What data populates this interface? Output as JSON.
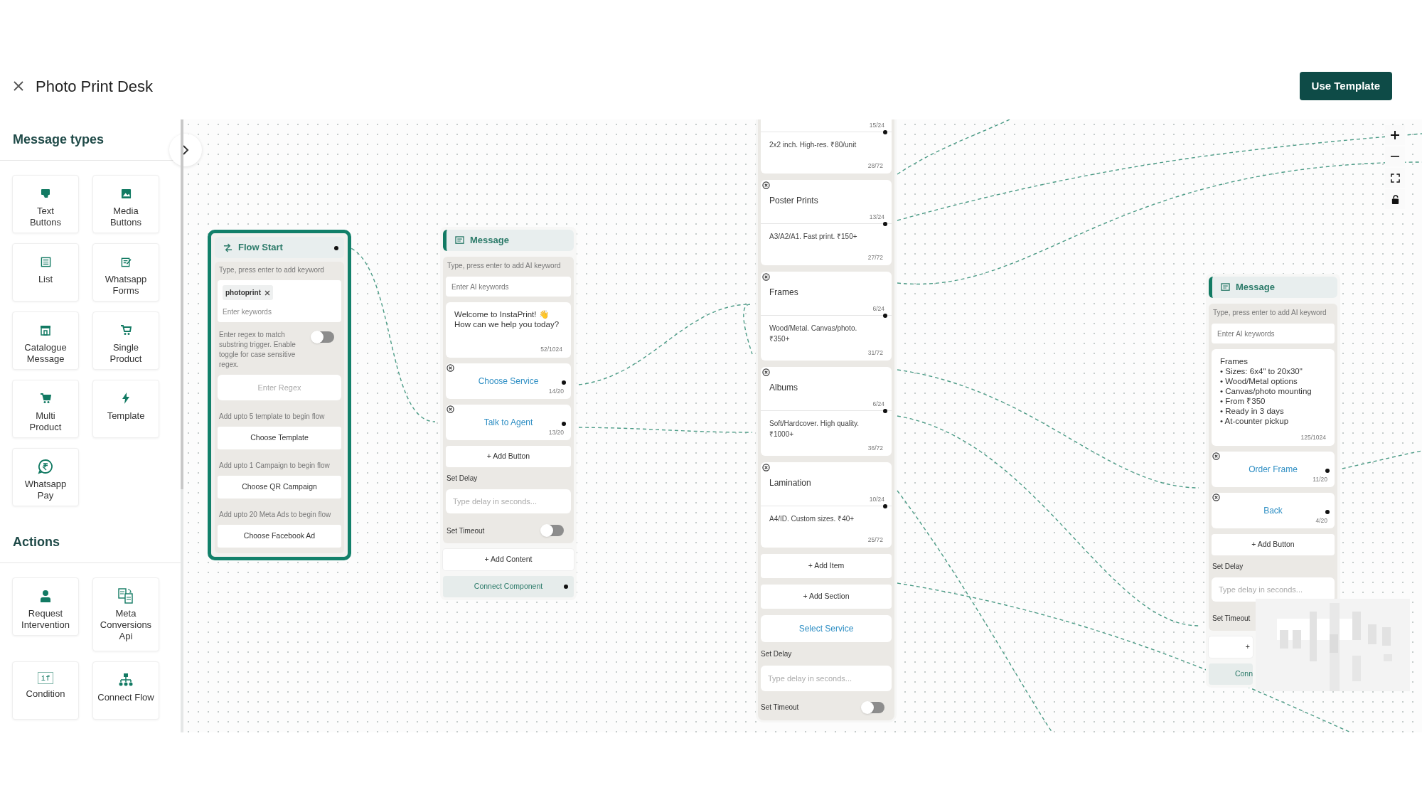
{
  "header": {
    "title": "Photo Print Desk",
    "action": "Use Template"
  },
  "sidebar": {
    "sections": [
      {
        "title": "Message types",
        "items": [
          {
            "label": "Text\nButtons"
          },
          {
            "label": "Media\nButtons"
          },
          {
            "label": "List"
          },
          {
            "label": "Whatsapp\nForms"
          },
          {
            "label": "Catalogue\nMessage"
          },
          {
            "label": "Single\nProduct"
          },
          {
            "label": "Multi\nProduct"
          },
          {
            "label": "Template"
          },
          {
            "label": "Whatsapp\nPay"
          }
        ]
      },
      {
        "title": "Actions",
        "items": [
          {
            "label": "Request\nIntervention"
          },
          {
            "label": "Meta\nConversions\nApi"
          },
          {
            "label": "Condition",
            "icon_text": "if"
          },
          {
            "label": "Connect Flow"
          }
        ]
      }
    ]
  },
  "flow_start": {
    "title": "Flow Start",
    "keyword_hint": "Type, press enter to add keyword",
    "keywords": [
      "photoprint"
    ],
    "keyword_placeholder": "Enter keywords",
    "regex_hint": "Enter regex to match substring trigger. Enable toggle for case sensitive regex.",
    "regex_case_sensitive": false,
    "regex_placeholder": "Enter Regex",
    "triggers": [
      {
        "hint": "Add upto 5 template to begin flow",
        "button": "Choose Template"
      },
      {
        "hint": "Add upto 1 Campaign to begin flow",
        "button": "Choose QR Campaign"
      },
      {
        "hint": "Add upto 20 Meta Ads to begin flow",
        "button": "Choose Facebook Ad"
      }
    ]
  },
  "message_nodes": [
    {
      "title": "Message",
      "ai_hint": "Type, press enter to add AI keyword",
      "ai_placeholder": "Enter AI keywords",
      "text": "Welcome to InstaPrint! 👋\nHow can we help you today?",
      "text_count": "52/1024",
      "buttons": [
        {
          "label": "Choose Service",
          "count": "14/20"
        },
        {
          "label": "Talk to Agent",
          "count": "13/20"
        }
      ],
      "add_button": "+ Add Button",
      "delay_label": "Set Delay",
      "delay_placeholder": "Type delay in seconds...",
      "timeout_label": "Set Timeout",
      "timeout": false,
      "add_content": "+ Add Content",
      "connect": "Connect Component"
    },
    {
      "title": "Message",
      "ai_hint": "Type, press enter to add AI keyword",
      "ai_placeholder": "Enter AI keywords",
      "text": "Frames\n• Sizes: 6x4\" to 20x30\"\n• Wood/Metal options\n• Canvas/photo mounting\n• From ₹350\n• Ready in 3 days\n• At-counter pickup",
      "text_count": "125/1024",
      "buttons": [
        {
          "label": "Order Frame",
          "count": "11/20"
        },
        {
          "label": "Back",
          "count": "4/20"
        }
      ],
      "add_button": "+ Add Button",
      "delay_label": "Set Delay",
      "delay_placeholder": "Type delay in seconds...",
      "timeout_label": "Set Timeout",
      "add_content": "+",
      "connect": "Conn"
    }
  ],
  "list_node": {
    "items": [
      {
        "title_count": "15/24",
        "description": "2x2 inch. High-res. ₹80/unit",
        "description_count": "28/72"
      },
      {
        "title": "Poster Prints",
        "title_count": "13/24",
        "description": "A3/A2/A1. Fast print. ₹150+",
        "description_count": "27/72"
      },
      {
        "title": "Frames",
        "title_count": "6/24",
        "description": "Wood/Metal. Canvas/photo. ₹350+",
        "description_count": "31/72"
      },
      {
        "title": "Albums",
        "title_count": "6/24",
        "description": "Soft/Hardcover. High quality. ₹1000+",
        "description_count": "36/72"
      },
      {
        "title": "Lamination",
        "title_count": "10/24",
        "description": "A4/ID. Custom sizes. ₹40+",
        "description_count": "25/72"
      }
    ],
    "add_item": "+ Add Item",
    "add_section": "+ Add Section",
    "button": "Select Service",
    "delay_label": "Set Delay",
    "delay_placeholder": "Type delay in seconds...",
    "timeout_label": "Set Timeout",
    "timeout": false
  }
}
